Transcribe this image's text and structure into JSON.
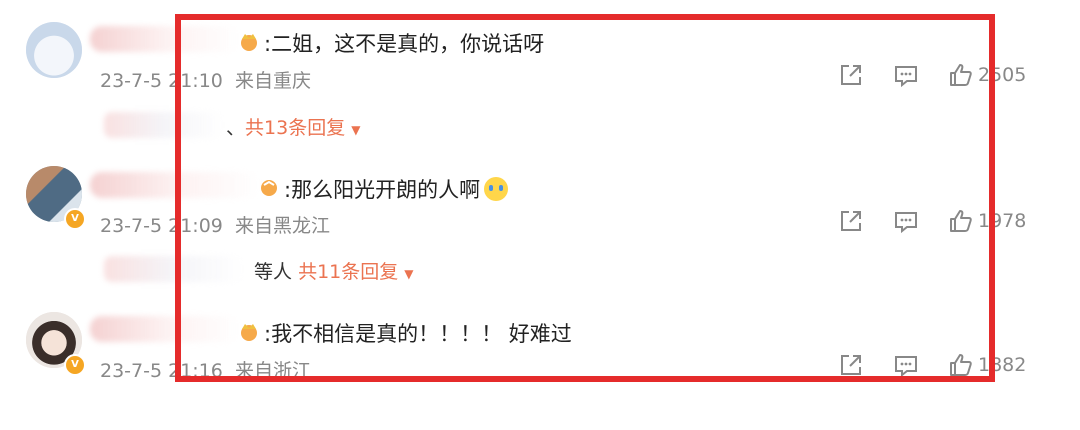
{
  "comments": [
    {
      "text": ":二姐，这不是真的，你说话呀",
      "date": "23-7-5",
      "time": "21:10",
      "location": "来自重庆",
      "likes": "2505",
      "reply_who": "、",
      "reply_count": "共13条回复"
    },
    {
      "text": ":那么阳光开朗的人啊",
      "date": "23-7-5",
      "time": "21:09",
      "location": "来自黑龙江",
      "likes": "1978",
      "reply_who": "等人",
      "reply_count": "共11条回复"
    },
    {
      "text": ":我不相信是真的！！！！ 好难过",
      "date": "23-7-5",
      "time": "21:16",
      "location": "来自浙江",
      "likes": "1882"
    }
  ],
  "icons": {
    "share": "share-icon",
    "comment": "comment-icon",
    "like": "like-icon",
    "caret": "caret-down-icon"
  },
  "colors": {
    "highlight_box": "#e52b2b",
    "reply_link": "#eb7350",
    "meta_text": "#888888"
  }
}
